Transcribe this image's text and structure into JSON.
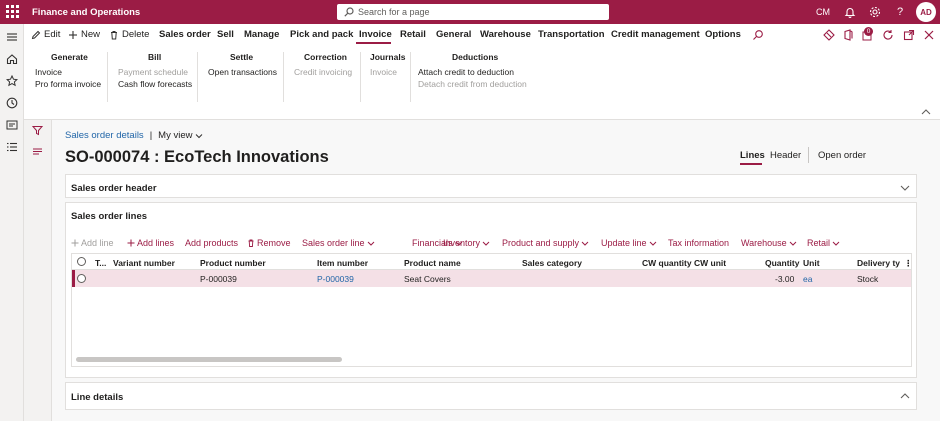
{
  "topbar": {
    "app_title": "Finance and Operations",
    "search_placeholder": "Search for a page",
    "company": "CM",
    "avatar_initials": "AD"
  },
  "actions": {
    "edit": "Edit",
    "new": "New",
    "delete": "Delete",
    "tabs": [
      "Sales order",
      "Sell",
      "Manage",
      "Pick and pack",
      "Invoice",
      "Retail",
      "General",
      "Warehouse",
      "Transportation",
      "Credit management",
      "Options"
    ],
    "active_tab": "Invoice",
    "notification_count": "0"
  },
  "ribbon": {
    "generate": {
      "header": "Generate",
      "items": [
        "Invoice",
        "Pro forma invoice"
      ]
    },
    "bill": {
      "header": "Bill",
      "items": [
        "Payment schedule",
        "Cash flow forecasts"
      ]
    },
    "settle": {
      "header": "Settle",
      "items": [
        "Open transactions"
      ]
    },
    "correction": {
      "header": "Correction",
      "items": [
        "Credit invoicing"
      ]
    },
    "journals": {
      "header": "Journals",
      "items": [
        "Invoice"
      ]
    },
    "deductions": {
      "header": "Deductions",
      "items": [
        "Attach credit to deduction",
        "Detach credit from deduction"
      ]
    }
  },
  "page": {
    "breadcrumb": "Sales order details",
    "view": "My view",
    "title": "SO-000074 : EcoTech Innovations",
    "view_tabs": [
      "Lines",
      "Header"
    ],
    "open_order": "Open order"
  },
  "sections": {
    "header": "Sales order header",
    "lines": "Sales order lines",
    "line_details": "Line details"
  },
  "lines_toolbar": {
    "add_line": "Add line",
    "add_lines": "Add lines",
    "add_products": "Add products",
    "remove": "Remove",
    "menus": [
      "Sales order line",
      "Financials",
      "Inventory",
      "Product and supply",
      "Update line"
    ],
    "tax_information": "Tax information",
    "menus2": [
      "Warehouse",
      "Retail"
    ]
  },
  "grid": {
    "columns": [
      "T...",
      "Variant number",
      "Product number",
      "Item number",
      "Product name",
      "Sales category",
      "CW quantity",
      "CW unit",
      "Quantity",
      "Unit",
      "Delivery ty"
    ],
    "rows": [
      {
        "product_number": "P-000039",
        "item_number": "P-000039",
        "product_name": "Seat Covers",
        "quantity": "-3.00",
        "unit": "ea",
        "delivery_type": "Stock"
      }
    ]
  },
  "colors": {
    "brand": "#9b1c45",
    "link": "#2266a8"
  }
}
